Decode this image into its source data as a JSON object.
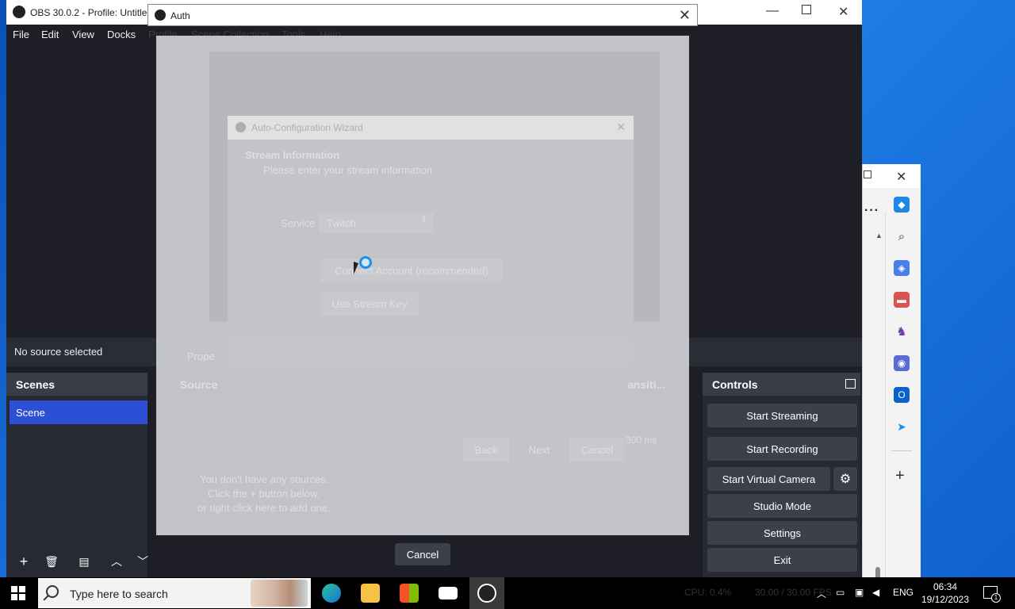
{
  "obs": {
    "title": "OBS 30.0.2 - Profile: Untitled",
    "menu": [
      "File",
      "Edit",
      "View",
      "Docks",
      "Profile",
      "Scene Collection",
      "Tools",
      "Help"
    ],
    "no_source": "No source selected",
    "properties_ghost": "Prope",
    "scenes_header": "Scenes",
    "scene_item": "Scene",
    "sources_header": "Source",
    "transitions_header": "ansiti...",
    "duration": "300 ms",
    "empty_sources": [
      "You don't have any sources.",
      "Click the + button below,",
      "or right click here to add one."
    ],
    "controls_header": "Controls",
    "controls": {
      "start_streaming": "Start Streaming",
      "start_recording": "Start Recording",
      "start_virtual_camera": "Start Virtual Camera",
      "studio_mode": "Studio Mode",
      "settings": "Settings",
      "exit": "Exit"
    }
  },
  "auth": {
    "title": "Auth",
    "cancel_label": "Cancel",
    "wizard": {
      "title": "Auto-Configuration Wizard",
      "heading": "Stream Information",
      "subheading": "Please enter your stream information",
      "service_label": "Service",
      "service_value": "Twitch",
      "connect_account": "Connect Account (recommended)",
      "use_stream_key": "Use Stream Key",
      "back": "Back",
      "next": "Next",
      "cancel": "Cancel"
    }
  },
  "taskbar": {
    "search_placeholder": "Type here to search",
    "tray_language": "ENG",
    "time": "06:34",
    "date": "19/12/2023",
    "notification_count": "1",
    "status_cpu": "CPU: 0.4%",
    "status_fps": "30.00 / 30.00 FPS"
  }
}
